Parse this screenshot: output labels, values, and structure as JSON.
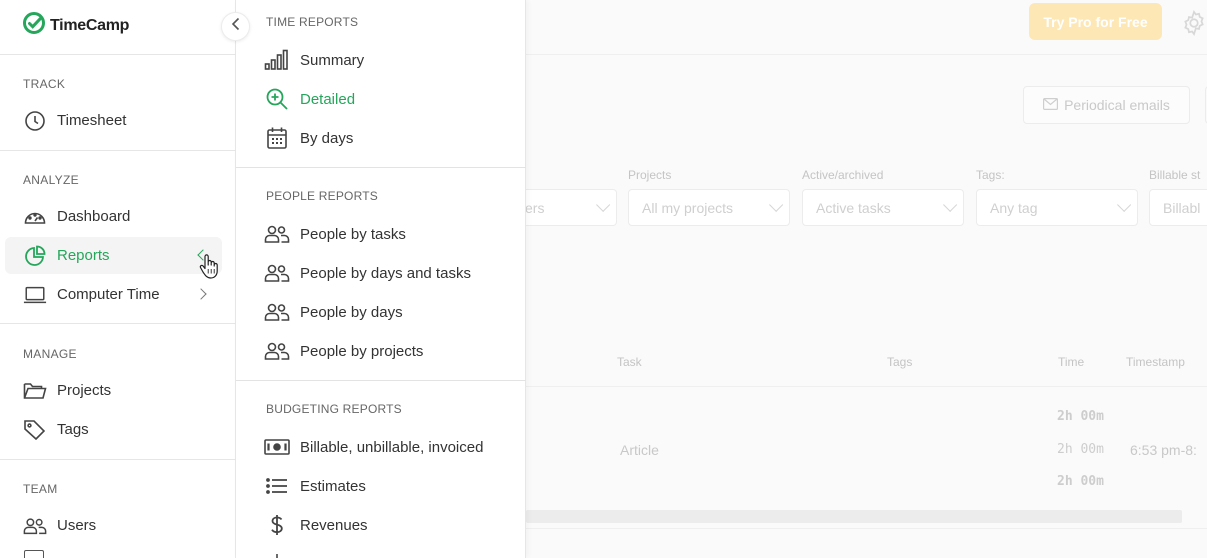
{
  "app": {
    "name": "TimeCamp",
    "brand_color": "#25a65b"
  },
  "topbar": {
    "try_pro_label": "Try Pro for Free"
  },
  "background": {
    "periodical_emails_label": "Periodical emails",
    "filters": [
      {
        "label": "",
        "value": "ers"
      },
      {
        "label": "Projects",
        "value": "All my projects"
      },
      {
        "label": "Active/archived",
        "value": "Active tasks"
      },
      {
        "label": "Tags:",
        "value": "Any tag"
      },
      {
        "label": "Billable st",
        "value": "Billabl"
      }
    ],
    "table": {
      "headers": [
        "Task",
        "Tags",
        "Time",
        "Timestamp"
      ],
      "task": "Article",
      "times": [
        "2h  00m",
        "2h  00m",
        "2h  00m"
      ],
      "timestamp": "6:53 pm-8:"
    }
  },
  "sidebar": {
    "collapse_icon": "chevron-left-icon",
    "sections": [
      {
        "heading": "TRACK",
        "items": [
          {
            "label": "Timesheet",
            "icon": "clock-icon"
          }
        ]
      },
      {
        "heading": "ANALYZE",
        "items": [
          {
            "label": "Dashboard",
            "icon": "gauge-icon"
          },
          {
            "label": "Reports",
            "icon": "pie-chart-icon",
            "active": true
          },
          {
            "label": "Computer Time",
            "icon": "laptop-icon"
          }
        ]
      },
      {
        "heading": "MANAGE",
        "items": [
          {
            "label": "Projects",
            "icon": "folder-icon"
          },
          {
            "label": "Tags",
            "icon": "tag-icon"
          }
        ]
      },
      {
        "heading": "TEAM",
        "items": [
          {
            "label": "Users",
            "icon": "users-icon"
          }
        ]
      }
    ]
  },
  "flyout": {
    "time_reports": {
      "heading": "TIME REPORTS",
      "items": [
        {
          "label": "Summary",
          "icon": "bar-chart-icon"
        },
        {
          "label": "Detailed",
          "icon": "zoom-in-icon",
          "active": true
        },
        {
          "label": "By days",
          "icon": "calendar-icon"
        }
      ]
    },
    "people_reports": {
      "heading": "PEOPLE REPORTS",
      "items": [
        {
          "label": "People by tasks",
          "icon": "people-icon"
        },
        {
          "label": "People by days and tasks",
          "icon": "people-icon"
        },
        {
          "label": "People by days",
          "icon": "people-icon"
        },
        {
          "label": "People by projects",
          "icon": "people-icon"
        }
      ]
    },
    "budgeting_reports": {
      "heading": "BUDGETING REPORTS",
      "items": [
        {
          "label": "Billable, unbillable, invoiced",
          "icon": "banknote-icon"
        },
        {
          "label": "Estimates",
          "icon": "list-icon"
        },
        {
          "label": "Revenues",
          "icon": "dollar-icon"
        }
      ]
    }
  }
}
